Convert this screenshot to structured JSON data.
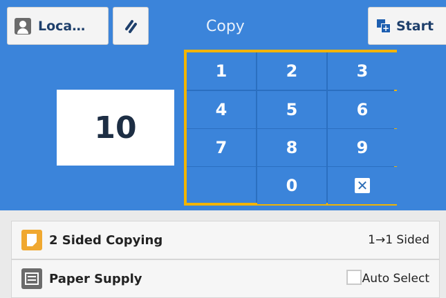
{
  "header": {
    "location_label": "Loca…",
    "title": "Copy",
    "start_label": "Start"
  },
  "count": {
    "value": "10"
  },
  "keypad": {
    "keys": [
      "1",
      "2",
      "3",
      "4",
      "5",
      "6",
      "7",
      "8",
      "9",
      "0"
    ],
    "clear_icon": "clear-x-icon"
  },
  "settings": {
    "items": [
      {
        "label": "2 Sided Copying",
        "value": "1→1 Sided",
        "icon": "two-sided-icon"
      },
      {
        "label": "Paper Supply",
        "value": "Auto Select",
        "icon": "paper-tray-icon"
      }
    ]
  },
  "colors": {
    "panel_bg": "#3b84da",
    "highlight": "#f2b400",
    "accent": "#f0a830"
  }
}
